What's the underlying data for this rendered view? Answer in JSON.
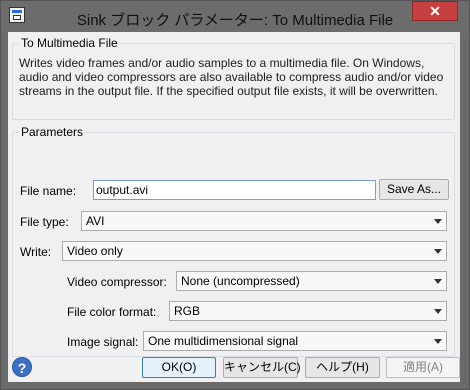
{
  "window": {
    "title": "Sink ブロック パラメーター: To Multimedia File",
    "close_glyph": "✕"
  },
  "description": {
    "group_title": "To Multimedia File",
    "text": "Writes video frames and/or audio samples to a multimedia file. On Windows, audio and video compressors are also available to compress audio and/or video streams in the output file. If the specified output file exists, it will be overwritten."
  },
  "parameters": {
    "group_title": "Parameters",
    "file_name": {
      "label": "File name:",
      "value": "output.avi"
    },
    "save_as_label": "Save As...",
    "file_type": {
      "label": "File type:",
      "value": "AVI"
    },
    "write": {
      "label": "Write:",
      "value": "Video only"
    },
    "video_compressor": {
      "label": "Video compressor:",
      "value": "None (uncompressed)"
    },
    "file_color_format": {
      "label": "File color format:",
      "value": "RGB"
    },
    "image_signal": {
      "label": "Image signal:",
      "value": "One multidimensional signal"
    }
  },
  "buttons": {
    "help_glyph": "?",
    "ok": "OK(O)",
    "cancel": "キャンセル(C)",
    "help": "ヘルプ(H)",
    "apply": "適用(A)"
  }
}
